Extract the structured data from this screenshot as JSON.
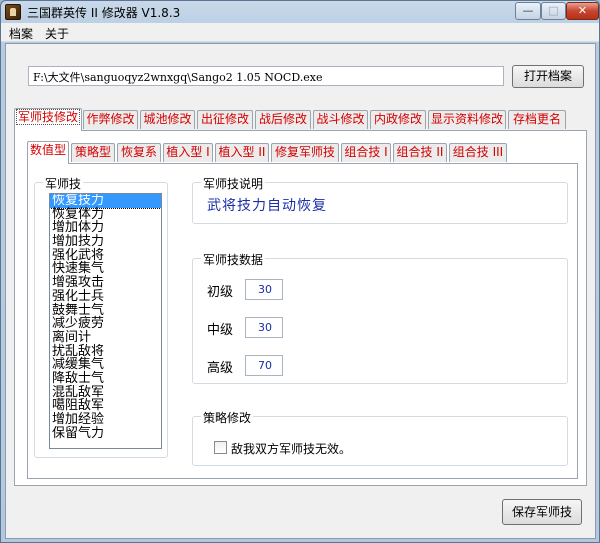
{
  "window": {
    "title": "三国群英传 II 修改器 V1.8.3",
    "controls": {
      "minimize": "—",
      "maximize": "□",
      "close": "✕"
    }
  },
  "menu": [
    "档案",
    "关于"
  ],
  "file": {
    "path": "F:\\大文件\\sanguoqyz2wnxgq\\Sango2 1.05 NOCD.exe",
    "open_button": "打开档案"
  },
  "main_tabs": [
    "军师技修改",
    "作弊修改",
    "城池修改",
    "出征修改",
    "战后修改",
    "战斗修改",
    "内政修改",
    "显示资料修改",
    "存档更名"
  ],
  "sub_tabs": [
    "数值型",
    "策略型",
    "恢复系",
    "植入型 I",
    "植入型 II",
    "修复军师技",
    "组合技 I",
    "组合技 II",
    "组合技 III"
  ],
  "skills_group": {
    "label": "军师技",
    "items": [
      "恢复技力",
      "恢复体力",
      "增加体力",
      "增加技力",
      "强化武将",
      "快速集气",
      "增强攻击",
      "强化士兵",
      "鼓舞士气",
      "减少疲劳",
      "离间计",
      "扰乱敌将",
      "减缓集气",
      "降敌士气",
      "混乱敌军",
      "噶阻敌军",
      "增加经验",
      "保留气力"
    ],
    "selected_index": 0
  },
  "description": {
    "label": "军师技说明",
    "text": "武将技力自动恢复"
  },
  "data_group": {
    "label": "军师技数据",
    "rows": [
      {
        "label": "初级",
        "value": "30"
      },
      {
        "label": "中级",
        "value": "30"
      },
      {
        "label": "高级",
        "value": "70"
      }
    ]
  },
  "strategy_group": {
    "label": "策略修改",
    "checkbox_label": "敌我双方军师技无效。",
    "checked": false
  },
  "save_button": "保存军师技"
}
